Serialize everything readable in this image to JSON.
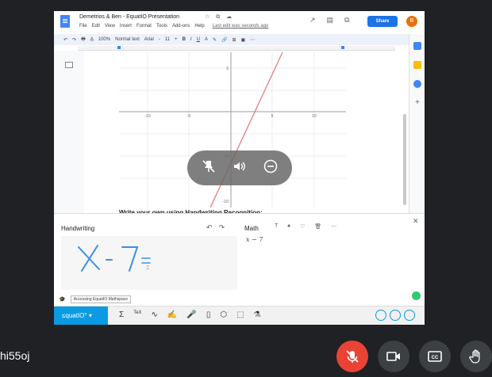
{
  "doc": {
    "title": "Demetrios & Ben - EquatIO Presentation",
    "star_icons": "☆ ⧉ ☁",
    "menu": [
      "File",
      "Edit",
      "View",
      "Insert",
      "Format",
      "Tools",
      "Add-ons",
      "Help"
    ],
    "last_edit": "Last edit was seconds ago",
    "share_label": "Share",
    "account_initial": "B",
    "toolbar": [
      "↶",
      "↷",
      "🖶",
      "A̲",
      "100%",
      "Normal text",
      "Arial",
      "-",
      "11",
      "+",
      "B",
      "I",
      "U",
      "A",
      "✎",
      "🔗",
      "⊞",
      "▣",
      "⋯"
    ],
    "section_heading": "Write your own using Handwriting Recognition:"
  },
  "graph": {
    "x_ticks": [
      "-10",
      "-5",
      "5",
      "10"
    ],
    "y_ticks": [
      "5",
      "-5",
      "-10"
    ]
  },
  "media": {
    "pin_icon": "pin-off-icon",
    "sound_icon": "volume-icon",
    "minus_icon": "remove-icon"
  },
  "equatio": {
    "handwriting_label": "Handwriting",
    "handwriting_strokes": "X - 7 =",
    "math_label": "Math",
    "math_expression": "x − 7",
    "math_tools": [
      "T",
      "♠",
      "♡",
      "🗑",
      "⋯"
    ],
    "footer_text": "Accessing EquatIO Mathspace",
    "logo_text": "≤quatIO° ▾",
    "tools": [
      "Σ",
      "TeX",
      "∿",
      "✍",
      "🎤",
      "▯",
      "⬡",
      "⬚",
      "⚗"
    ]
  },
  "meet": {
    "participant_name": "hi55oj"
  },
  "colors": {
    "mic_off": "#ea4335",
    "share_blue": "#1a73e8",
    "equatio_blue": "#0b9be3",
    "line_red": "#e57373",
    "handwriting_blue": "#3d8fe0"
  }
}
